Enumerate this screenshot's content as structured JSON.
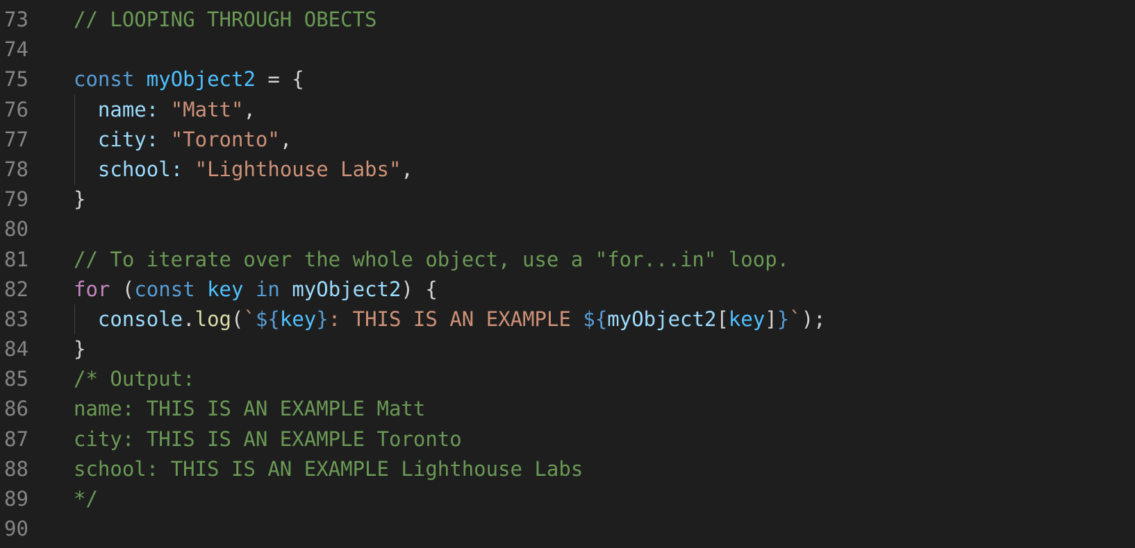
{
  "editor": {
    "colors": {
      "background": "#1e1e1e",
      "line_number": "#858585",
      "comment": "#6a9955",
      "keyword": "#569cd6",
      "control_keyword": "#c586c0",
      "constant_variable": "#4fc1ff",
      "property": "#9cdcfe",
      "string": "#ce9178",
      "function": "#dcdcaa",
      "punctuation": "#d4d4d4"
    },
    "lines": [
      {
        "num": "73",
        "guide": false,
        "tokens": [
          {
            "t": "comment",
            "v": "// LOOPING THROUGH OBECTS"
          }
        ]
      },
      {
        "num": "74",
        "guide": false,
        "tokens": []
      },
      {
        "num": "75",
        "guide": false,
        "tokens": [
          {
            "t": "keyword",
            "v": "const"
          },
          {
            "t": "punct",
            "v": " "
          },
          {
            "t": "constvar",
            "v": "myObject2"
          },
          {
            "t": "punct",
            "v": " = {"
          }
        ]
      },
      {
        "num": "76",
        "guide": true,
        "tokens": [
          {
            "t": "punct",
            "v": "  "
          },
          {
            "t": "prop",
            "v": "name"
          },
          {
            "t": "prop",
            "v": ": "
          },
          {
            "t": "string",
            "v": "\"Matt\""
          },
          {
            "t": "punct",
            "v": ","
          }
        ]
      },
      {
        "num": "77",
        "guide": true,
        "tokens": [
          {
            "t": "punct",
            "v": "  "
          },
          {
            "t": "prop",
            "v": "city"
          },
          {
            "t": "prop",
            "v": ": "
          },
          {
            "t": "string",
            "v": "\"Toronto\""
          },
          {
            "t": "punct",
            "v": ","
          }
        ]
      },
      {
        "num": "78",
        "guide": true,
        "tokens": [
          {
            "t": "punct",
            "v": "  "
          },
          {
            "t": "prop",
            "v": "school"
          },
          {
            "t": "prop",
            "v": ": "
          },
          {
            "t": "string",
            "v": "\"Lighthouse Labs\""
          },
          {
            "t": "punct",
            "v": ","
          }
        ]
      },
      {
        "num": "79",
        "guide": false,
        "tokens": [
          {
            "t": "punct",
            "v": "}"
          }
        ]
      },
      {
        "num": "80",
        "guide": false,
        "tokens": []
      },
      {
        "num": "81",
        "guide": false,
        "tokens": [
          {
            "t": "comment",
            "v": "// To iterate over the whole object, use a \"for...in\" loop."
          }
        ]
      },
      {
        "num": "82",
        "guide": false,
        "tokens": [
          {
            "t": "control",
            "v": "for"
          },
          {
            "t": "punct",
            "v": " ("
          },
          {
            "t": "keyword",
            "v": "const"
          },
          {
            "t": "punct",
            "v": " "
          },
          {
            "t": "constvar",
            "v": "key"
          },
          {
            "t": "punct",
            "v": " "
          },
          {
            "t": "keyword",
            "v": "in"
          },
          {
            "t": "punct",
            "v": " "
          },
          {
            "t": "var",
            "v": "myObject2"
          },
          {
            "t": "punct",
            "v": ") {"
          }
        ]
      },
      {
        "num": "83",
        "guide": true,
        "tokens": [
          {
            "t": "punct",
            "v": "  "
          },
          {
            "t": "var",
            "v": "console"
          },
          {
            "t": "punct",
            "v": "."
          },
          {
            "t": "func",
            "v": "log"
          },
          {
            "t": "punct",
            "v": "("
          },
          {
            "t": "string",
            "v": "`"
          },
          {
            "t": "interp",
            "v": "${"
          },
          {
            "t": "constvar",
            "v": "key"
          },
          {
            "t": "interp",
            "v": "}"
          },
          {
            "t": "string",
            "v": ": THIS IS AN EXAMPLE "
          },
          {
            "t": "interp",
            "v": "${"
          },
          {
            "t": "var",
            "v": "myObject2"
          },
          {
            "t": "punct",
            "v": "["
          },
          {
            "t": "constvar",
            "v": "key"
          },
          {
            "t": "punct",
            "v": "]"
          },
          {
            "t": "interp",
            "v": "}"
          },
          {
            "t": "string",
            "v": "`"
          },
          {
            "t": "punct",
            "v": ");"
          }
        ]
      },
      {
        "num": "84",
        "guide": false,
        "tokens": [
          {
            "t": "punct",
            "v": "}"
          }
        ]
      },
      {
        "num": "85",
        "guide": false,
        "tokens": [
          {
            "t": "comment",
            "v": "/* Output:"
          }
        ]
      },
      {
        "num": "86",
        "guide": false,
        "tokens": [
          {
            "t": "comment",
            "v": "name: THIS IS AN EXAMPLE Matt"
          }
        ]
      },
      {
        "num": "87",
        "guide": false,
        "tokens": [
          {
            "t": "comment",
            "v": "city: THIS IS AN EXAMPLE Toronto"
          }
        ]
      },
      {
        "num": "88",
        "guide": false,
        "tokens": [
          {
            "t": "comment",
            "v": "school: THIS IS AN EXAMPLE Lighthouse Labs"
          }
        ]
      },
      {
        "num": "89",
        "guide": false,
        "tokens": [
          {
            "t": "comment",
            "v": "*/"
          }
        ]
      },
      {
        "num": "90",
        "guide": false,
        "tokens": []
      }
    ]
  }
}
